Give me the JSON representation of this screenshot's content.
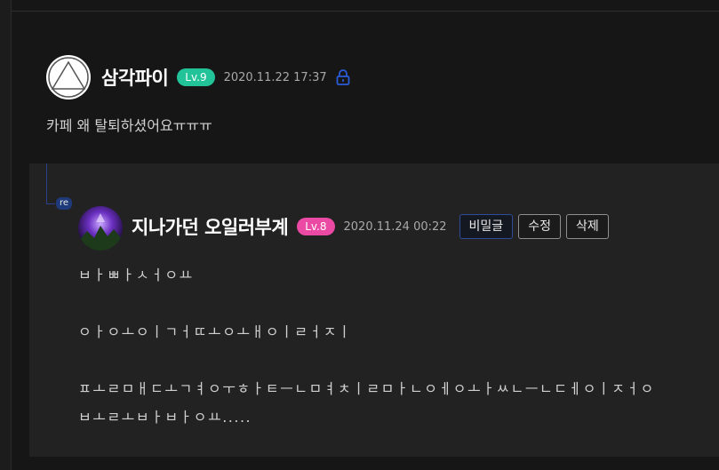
{
  "comment": {
    "nickname": "삼각파이",
    "level": "Lv.9",
    "date": "2020.11.22 17:37",
    "text": "카페 왜 탈퇴하셨어요ㅠㅠㅠ",
    "level_color": "#23c39a",
    "lock_icon": "lock-icon"
  },
  "reply": {
    "badge": "re",
    "nickname": "지나가던 오일러부계",
    "level": "Lv.8",
    "date": "2020.11.24 00:22",
    "level_color": "#ea4aa3",
    "buttons": {
      "secret": "비밀글",
      "edit": "수정",
      "delete": "삭제"
    },
    "lines": {
      "l1": "ㅂㅏㅃㅏㅅㅓㅇㅛ",
      "l2": "ㅇㅏㅇㅗㅇㅣㄱㅓㄸㅗㅇㅗㅐㅇㅣㄹㅓㅈㅣ",
      "l3": "ㅍㅗㄹㅁㅐㄷㅗㄱㅕㅇㅜㅎㅏㅌㅡㄴㅁㅕㅊㅣㄹㅁㅏㄴㅇㅔㅇㅗㅏㅆㄴㅡㄴㄷㅔㅇㅣㅈㅓㅇ",
      "l4": "ㅂㅗㄹㅗㅂㅏㅂㅏㅇㅛ....."
    }
  }
}
